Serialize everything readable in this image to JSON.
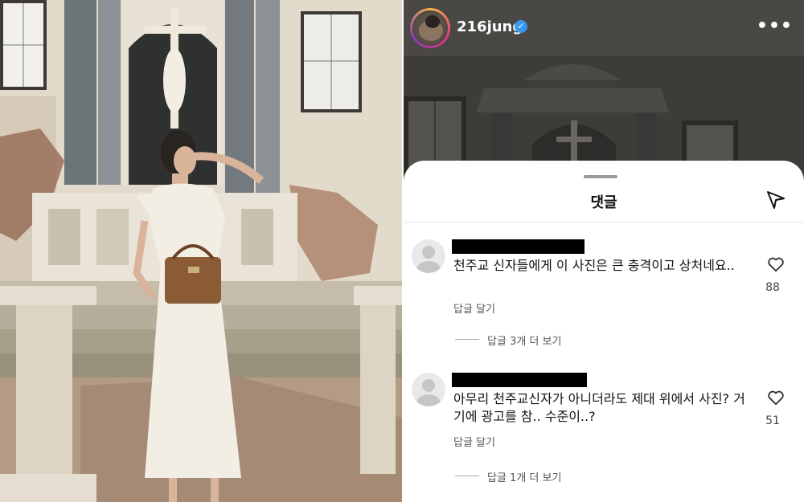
{
  "profile": {
    "username": "216jung",
    "verified_mark": "✓",
    "more_glyph": "•••",
    "avatar_icon": "profile-avatar"
  },
  "sheet": {
    "title": "댓글",
    "send_icon": "send-paper-plane-icon"
  },
  "comments": [
    {
      "text": "천주교 신자들에게 이 사진은 큰 충격이고 상처네요..",
      "reply_label": "답글 달기",
      "view_replies": "답글 3개 더 보기",
      "likes": "88"
    },
    {
      "text": "아무리 천주교신자가 아니더라도 제대 위에서 사진? 거기에 광고를 참.. 수준이..?",
      "reply_label": "답글 달기",
      "view_replies": "답글 1개 더 보기",
      "likes": "51"
    }
  ],
  "colors": {
    "header_bg": "#4a4845",
    "sheet_bg": "#ffffff",
    "verified": "#3897f0"
  }
}
